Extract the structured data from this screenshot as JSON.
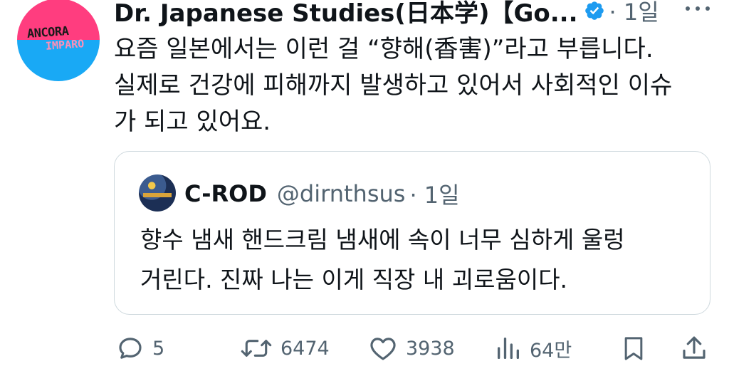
{
  "tweet": {
    "author_name": "Dr. Japanese Studies(日本学)【Go...",
    "time": "· 1일",
    "text_lines": [
      "요즘 일본에서는 이런 걸 “향해(香害)”라고 부릅니다.",
      "실제로 건강에 피해까지 발생하고 있어서 사회적인 이슈",
      "가 되고 있어요."
    ],
    "avatar_text": [
      "ANCORA",
      "IMPARO"
    ]
  },
  "quote": {
    "name": "C-ROD",
    "handle": "@dirnthsus",
    "time": "· 1일",
    "text_lines": [
      "향수 냄새 핸드크림 냄새에 속이 너무 심하게 울렁",
      "거린다. 진짜 나는 이게 직장 내 괴로움이다."
    ]
  },
  "actions": {
    "replies": "5",
    "retweets": "6474",
    "likes": "3938",
    "views": "64만"
  },
  "icons": [
    "verified-badge-icon",
    "more-icon",
    "reply-icon",
    "retweet-icon",
    "like-icon",
    "views-icon",
    "bookmark-icon",
    "share-icon"
  ],
  "colors": {
    "verified": "#1d9bf0",
    "secondary_text": "#536471",
    "border": "#cfd9de"
  }
}
